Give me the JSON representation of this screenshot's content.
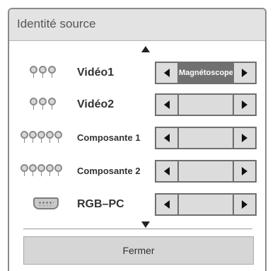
{
  "dialog": {
    "title": "Identité source",
    "close_label": "Fermer"
  },
  "sources": [
    {
      "label": "Vidéo1",
      "value": "Magnétoscope",
      "icon": "composite-3-plug-icon"
    },
    {
      "label": "Vidéo2",
      "value": "",
      "icon": "composite-3-plug-icon"
    },
    {
      "label": "Composante 1",
      "value": "",
      "icon": "component-5-plug-icon"
    },
    {
      "label": "Composante 2",
      "value": "",
      "icon": "component-5-plug-icon"
    },
    {
      "label": "RGB–PC",
      "value": "",
      "icon": "rgb-pc-dsub-icon"
    }
  ],
  "icons": {
    "scroll_up": "scroll-up-icon",
    "scroll_down": "scroll-down-icon",
    "prev": "arrow-left-icon",
    "next": "arrow-right-icon"
  },
  "colors": {
    "title_bar": "#e3e3e3",
    "selected_value_bg": "#707070",
    "selector_bg": "#dcdcdc",
    "close_button_bg": "#d6d6d6"
  }
}
